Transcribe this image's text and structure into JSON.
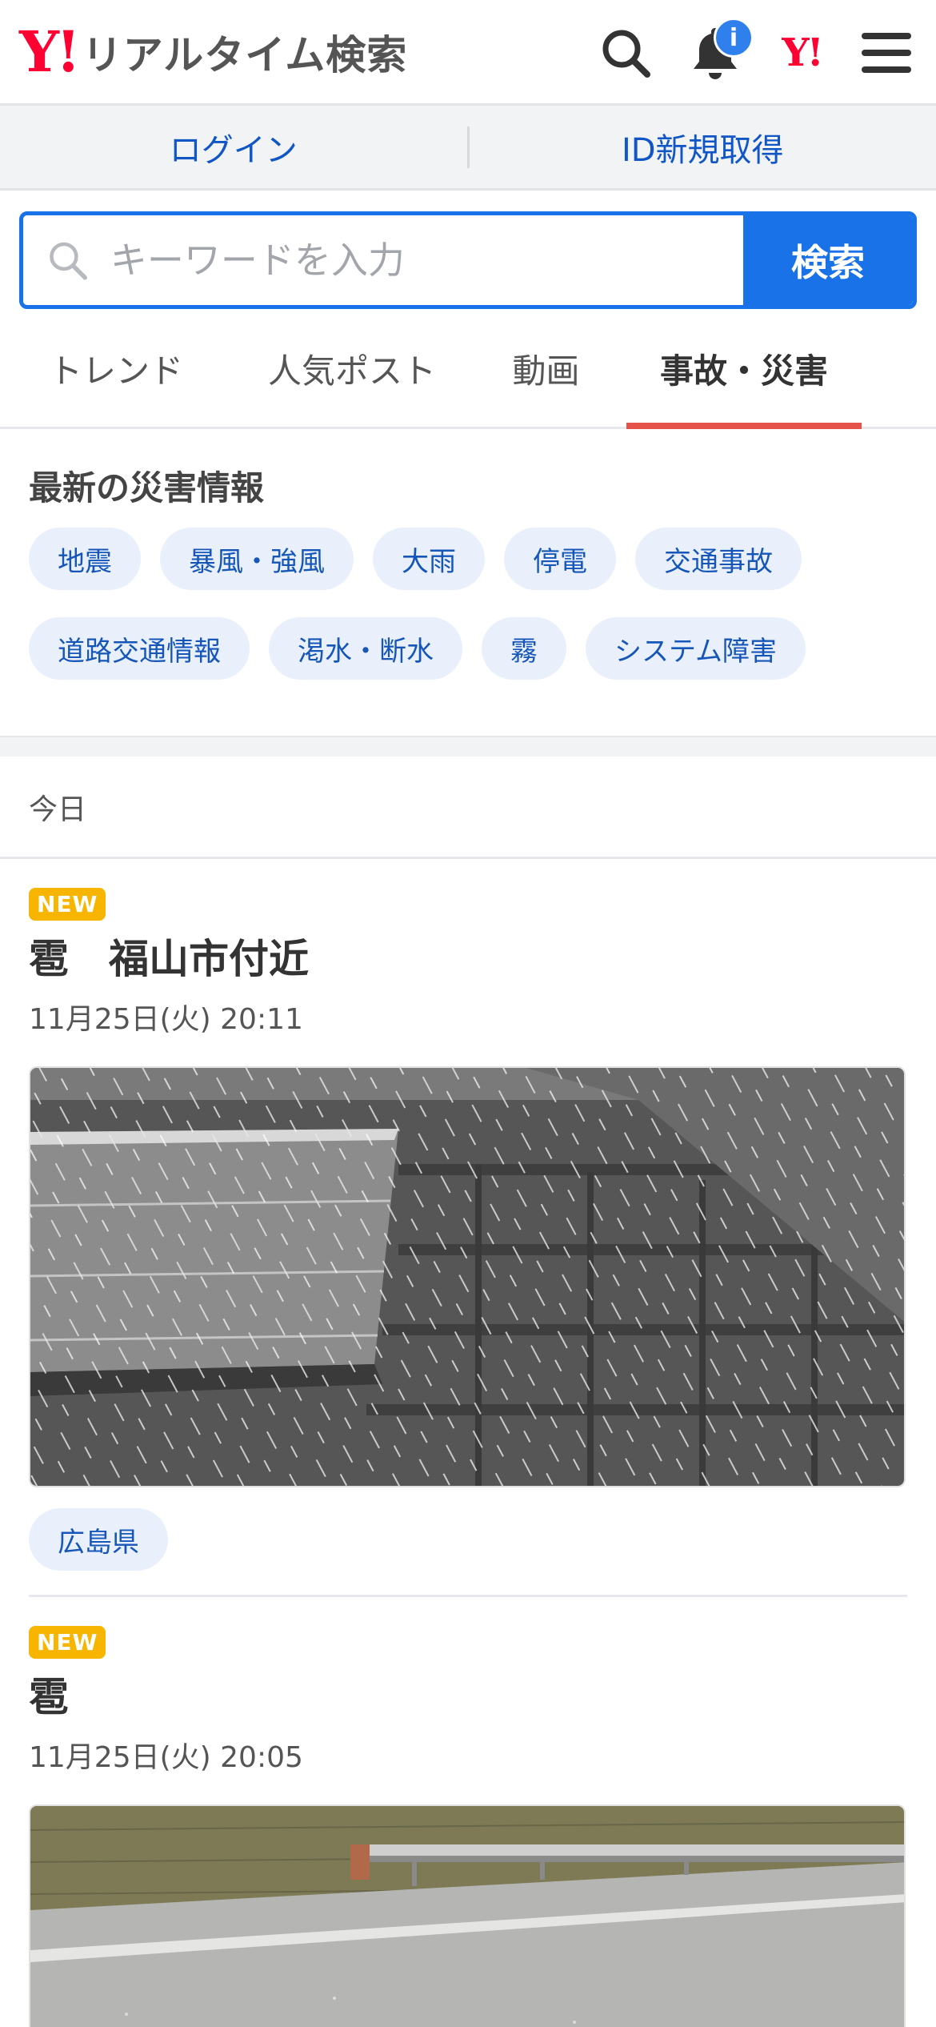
{
  "header": {
    "logo_mark": "Y!",
    "logo_text": "リアルタイム検索",
    "notification_badge": "i",
    "yahoo_mark": "Y!"
  },
  "auth": {
    "login": "ログイン",
    "signup": "ID新規取得"
  },
  "search": {
    "placeholder": "キーワードを入力",
    "value": "",
    "submit": "検索"
  },
  "tabs": [
    "トレンド",
    "人気ポスト",
    "動画",
    "事故・災害"
  ],
  "active_tab": "事故・災害",
  "disaster_info": {
    "title": "最新の災害情報",
    "chips": [
      "地震",
      "暴風・強風",
      "大雨",
      "停電",
      "交通事故",
      "道路交通情報",
      "渇水・断水",
      "霧",
      "システム障害"
    ]
  },
  "day_header": "今日",
  "articles": [
    {
      "badge": "NEW",
      "title": "雹　福山市付近",
      "time": "11月25日(火) 20:11",
      "tag": "広島県"
    },
    {
      "badge": "NEW",
      "title": "雹",
      "time": "11月25日(火) 20:05"
    }
  ],
  "colors": {
    "brand_red": "#ff0033",
    "accent_blue": "#1a72e8",
    "active_tab_underline": "#e5524a",
    "new_badge": "#f7b500"
  },
  "icons": [
    "search-icon",
    "bell-icon",
    "yahoo-japan-icon",
    "hamburger-menu-icon",
    "magnifier-icon"
  ]
}
